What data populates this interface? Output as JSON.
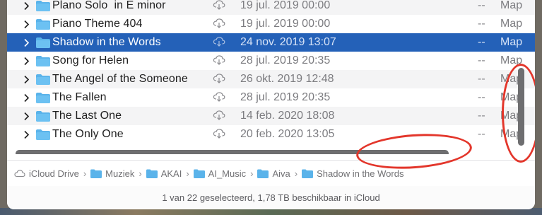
{
  "rows": [
    {
      "name": "Plano Solo  in E minor",
      "date": "19 jul. 2019 00:00",
      "size": "--",
      "kind": "Map",
      "selected": false
    },
    {
      "name": "Piano Theme 404",
      "date": "19 jul. 2019 00:00",
      "size": "--",
      "kind": "Map",
      "selected": false
    },
    {
      "name": "Shadow in the Words",
      "date": "24 nov. 2019 13:07",
      "size": "--",
      "kind": "Map",
      "selected": true
    },
    {
      "name": "Song for Helen",
      "date": "28 jul. 2019 20:35",
      "size": "--",
      "kind": "Map",
      "selected": false
    },
    {
      "name": "The Angel of the Someone",
      "date": "26 okt. 2019 12:48",
      "size": "--",
      "kind": "Map",
      "selected": false
    },
    {
      "name": "The Fallen",
      "date": "28 jul. 2019 20:35",
      "size": "--",
      "kind": "Map",
      "selected": false
    },
    {
      "name": "The Last One",
      "date": "14 feb. 2020 18:08",
      "size": "--",
      "kind": "Map",
      "selected": false
    },
    {
      "name": "The Only One",
      "date": "20 feb. 2020 13:05",
      "size": "--",
      "kind": "Map",
      "selected": false
    }
  ],
  "path": [
    "iCloud Drive",
    "Muziek",
    "AKAI",
    "AI_Music",
    "Aiva",
    "Shadow in the Words"
  ],
  "status": "1 van 22 geselecteerd, 1,78 TB beschikbaar in iCloud",
  "colors": {
    "selection": "#2461b8",
    "folder": "#5ab3ea",
    "annotation": "#e3362b"
  }
}
